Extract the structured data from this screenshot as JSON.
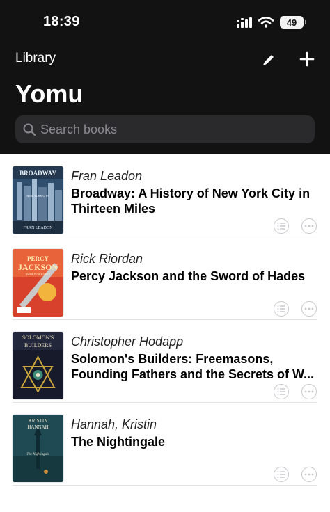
{
  "status": {
    "time": "18:39",
    "battery": "49"
  },
  "header": {
    "back_label": "Library",
    "title": "Yomu"
  },
  "search": {
    "placeholder": "Search books",
    "value": ""
  },
  "books": [
    {
      "author": "Fran Leadon",
      "title": "Broadway: A History of New York City in Thirteen Miles",
      "cover_text": [
        "BROADWAY",
        "NEW YORK CITY",
        "FRAN LEADON"
      ]
    },
    {
      "author": "Rick Riordan",
      "title": "Percy Jackson and the Sword of Hades",
      "cover_text": [
        "PERCY",
        "JACKSON",
        "SWORD OF HADES"
      ]
    },
    {
      "author": "Christopher Hodapp",
      "title": "Solomon's Builders: Freemasons, Founding Fathers and the Secrets of W...",
      "cover_text": [
        "SOLOMON'S",
        "BUILDERS"
      ]
    },
    {
      "author": "Hannah, Kristin",
      "title": "The Nightingale",
      "cover_text": [
        "KRISTIN",
        "HANNAH",
        "The Nightingale"
      ]
    }
  ],
  "icons": {
    "edit": "pencil-icon",
    "add": "plus-icon",
    "search": "magnifier-icon",
    "row_list": "list-icon",
    "row_more": "ellipsis-icon"
  },
  "colors": {
    "header_bg": "#121212",
    "search_bg": "#2a2a2c",
    "divider": "#e2e2e4",
    "action_icon": "#c8c8cc"
  }
}
